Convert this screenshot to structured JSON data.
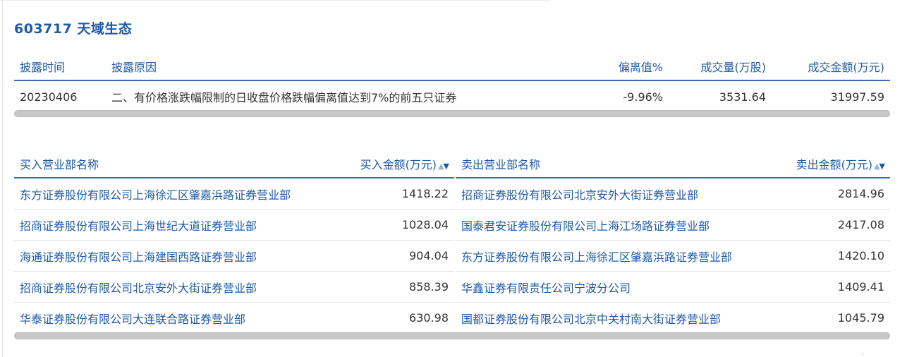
{
  "stock": {
    "title": "603717 天域生态"
  },
  "disclosure": {
    "headers": [
      "披露时间",
      "披露原因",
      "偏离值%",
      "成交量(万股)",
      "成交金额(万元)"
    ],
    "row": {
      "date": "20230406",
      "reason": "二、有价格涨跌幅限制的日收盘价格跌幅偏离值达到7%的前五只证券",
      "deviation": "-9.96%",
      "volume": "3531.64",
      "amount": "31997.59"
    }
  },
  "buy": {
    "name_header": "买入营业部名称",
    "amount_header": "买入金额(万元)",
    "sort_icon": "sort-up-down-icon",
    "rows": [
      {
        "name": "东方证券股份有限公司上海徐汇区肇嘉浜路证券营业部",
        "amount": "1418.22"
      },
      {
        "name": "招商证券股份有限公司上海世纪大道证券营业部",
        "amount": "1028.04"
      },
      {
        "name": "海通证券股份有限公司上海建国西路证券营业部",
        "amount": "904.04"
      },
      {
        "name": "招商证券股份有限公司北京安外大街证券营业部",
        "amount": "858.39"
      },
      {
        "name": "华泰证券股份有限公司大连联合路证券营业部",
        "amount": "630.98"
      }
    ]
  },
  "sell": {
    "name_header": "卖出营业部名称",
    "amount_header": "卖出金额(万元)",
    "sort_icon": "sort-up-down-icon",
    "rows": [
      {
        "name": "招商证券股份有限公司北京安外大街证券营业部",
        "amount": "2814.96"
      },
      {
        "name": "国泰君安证券股份有限公司上海江场路证券营业部",
        "amount": "2417.08"
      },
      {
        "name": "东方证券股份有限公司上海徐汇区肇嘉浜路证券营业部",
        "amount": "1420.10"
      },
      {
        "name": "华鑫证券有限责任公司宁波分公司",
        "amount": "1409.41"
      },
      {
        "name": "国都证券股份有限公司北京中关村南大街证券营业部",
        "amount": "1045.79"
      }
    ]
  },
  "colors": {
    "accent": "#1f5aa6",
    "text": "#333333",
    "scrollbar": "#c8c8c8"
  }
}
